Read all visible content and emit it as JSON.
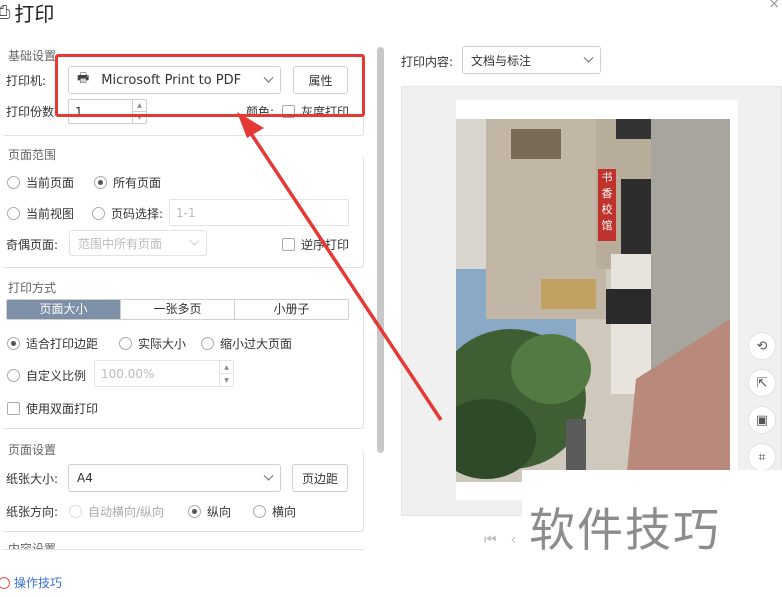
{
  "dialog": {
    "title": "打印",
    "close_glyph": "×"
  },
  "basic": {
    "group_label": "基础设置",
    "printer_label": "打印机:",
    "printer_value": "Microsoft Print to PDF",
    "properties_button": "属性",
    "copies_label": "打印份数:",
    "copies_value": "1",
    "color_label": "颜色:",
    "grayscale_label": "灰度打印"
  },
  "page_range": {
    "group_label": "页面范围",
    "current_page": "当前页面",
    "all_pages": "所有页面",
    "current_view": "当前视图",
    "page_select_label": "页码选择:",
    "page_select_placeholder": "1-1",
    "odd_even_label": "奇偶页面:",
    "odd_even_value": "范围中所有页面",
    "reverse_label": "逆序打印"
  },
  "print_mode": {
    "group_label": "打印方式",
    "tabs": [
      "页面大小",
      "一张多页",
      "小册子"
    ],
    "fit_margins": "适合打印边距",
    "actual_size": "实际大小",
    "shrink_large": "缩小过大页面",
    "custom_scale": "自定义比例",
    "scale_value": "100.00%",
    "duplex": "使用双面打印"
  },
  "page_setup": {
    "group_label": "页面设置",
    "paper_label": "纸张大小:",
    "paper_value": "A4",
    "margins_button": "页边距",
    "orientation_label": "纸张方向:",
    "auto_orient": "自动横向/纵向",
    "portrait": "纵向",
    "landscape": "横向"
  },
  "content_setup": {
    "group_label": "内容设置"
  },
  "preview": {
    "content_label": "打印内容:",
    "content_value": "文档与标注",
    "sign_text": "书香校馆",
    "icons": [
      "rotate-icon",
      "export-icon",
      "save-icon",
      "crop-icon"
    ],
    "pager_first": "⏮",
    "pager_prev": "‹"
  },
  "watermark": "软件技巧",
  "footer": {
    "tips_link": "操作技巧"
  },
  "colors": {
    "accent": "#7e8fa8",
    "annotation_red": "#e53935",
    "link": "#3b6fd6"
  }
}
